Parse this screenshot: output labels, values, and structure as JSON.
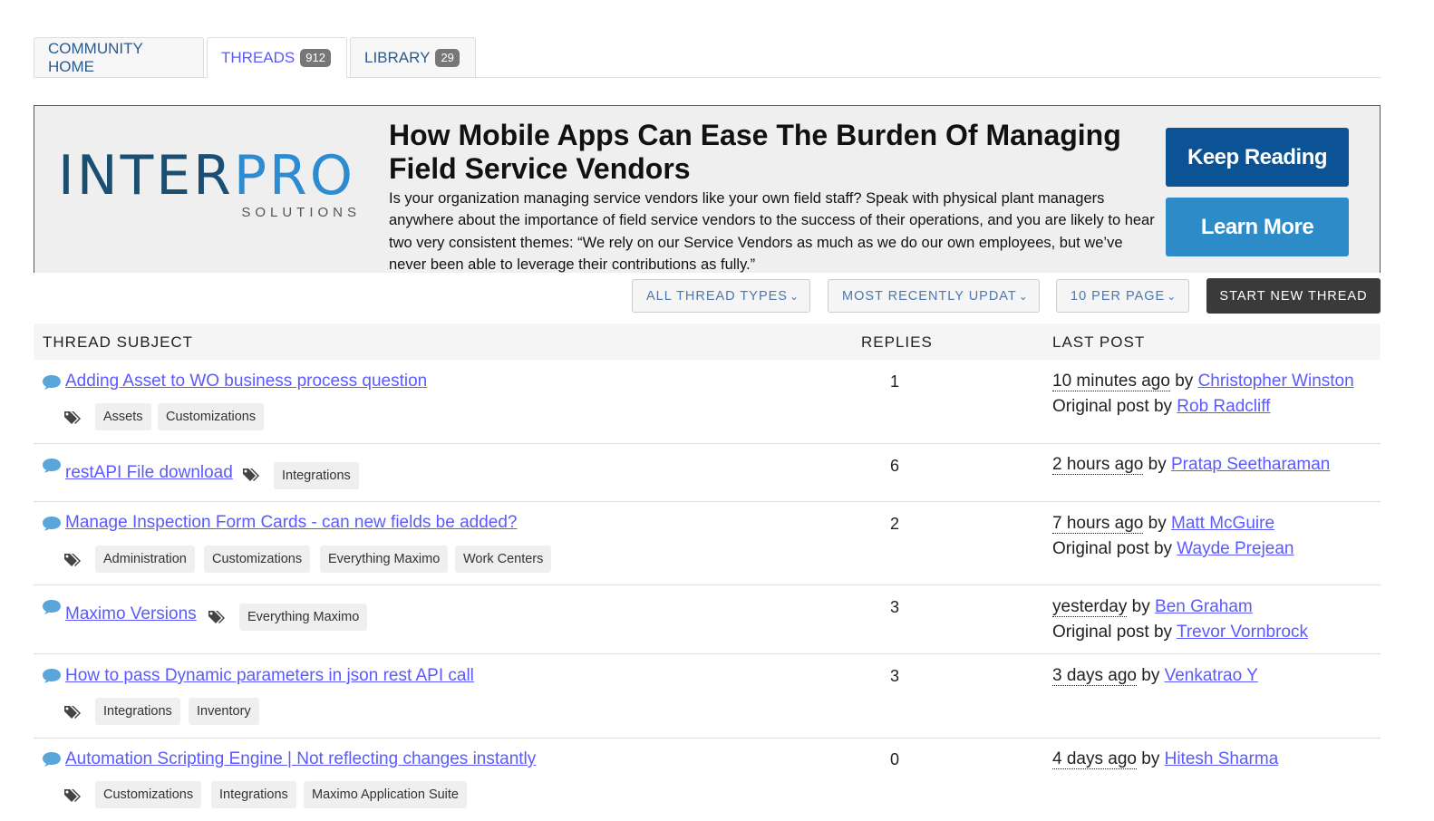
{
  "tabs": [
    {
      "label": "COMMUNITY HOME"
    },
    {
      "label": "THREADS",
      "count": "912"
    },
    {
      "label": "LIBRARY",
      "count": "29"
    }
  ],
  "banner": {
    "logo_main_a": "INTER",
    "logo_main_b": "PRO",
    "logo_sub": "SOLUTIONS",
    "title": "How Mobile Apps Can Ease The Burden Of Managing Field Service Vendors",
    "text": "Is your organization managing service vendors like your own field staff? Speak with physical plant managers anywhere about the importance of field service vendors to the success of their operations, and you are likely to hear two very consistent themes: “We rely on our Service Vendors as much as we do our own employees, but we’ve never been able to leverage their contributions as fully.”",
    "keep_reading": "Keep Reading",
    "learn_more": "Learn More"
  },
  "filters": {
    "thread_types": "ALL THREAD TYPES",
    "sort": "MOST RECENTLY UPDAT",
    "per_page": "10 PER PAGE",
    "start": "START NEW THREAD"
  },
  "table": {
    "col_subject": "THREAD SUBJECT",
    "col_replies": "REPLIES",
    "col_last": "LAST POST",
    "by": "by",
    "original_post_by": "Original post by",
    "rows": [
      {
        "title": "Adding Asset to WO business process question",
        "tags": [
          "Assets",
          "Customizations"
        ],
        "replies": "1",
        "time": "10 minutes ago",
        "last_user": "Christopher Winston",
        "orig_user": "Rob Radcliff"
      },
      {
        "title": "restAPI File download",
        "tags": [
          "Integrations"
        ],
        "replies": "6",
        "time": "2 hours ago",
        "last_user": "Pratap Seetharaman",
        "orig_user": ""
      },
      {
        "title": "Manage Inspection Form Cards - can new fields be added?",
        "tags": [
          "Administration",
          "Customizations",
          "Everything Maximo",
          "Work Centers"
        ],
        "replies": "2",
        "time": "7 hours ago",
        "last_user": "Matt McGuire",
        "orig_user": "Wayde Prejean"
      },
      {
        "title": "Maximo Versions",
        "tags": [
          "Everything Maximo"
        ],
        "replies": "3",
        "time": "yesterday",
        "last_user": "Ben Graham",
        "orig_user": "Trevor Vornbrock"
      },
      {
        "title": "How to pass Dynamic parameters in json rest API call",
        "tags": [
          "Integrations",
          "Inventory"
        ],
        "replies": "3",
        "time": "3 days ago",
        "last_user": "Venkatrao Y",
        "orig_user": ""
      },
      {
        "title": "Automation Scripting Engine | Not reflecting changes instantly",
        "tags": [
          "Customizations",
          "Integrations",
          "Maximo Application Suite"
        ],
        "replies": "0",
        "time": "4 days ago",
        "last_user": "Hitesh Sharma",
        "orig_user": ""
      }
    ]
  },
  "colors": {
    "link": "#5a5aff",
    "brand_dark": "#0b5394",
    "brand_light": "#2d8bc7",
    "chat_icon": "#5aa6d8"
  }
}
